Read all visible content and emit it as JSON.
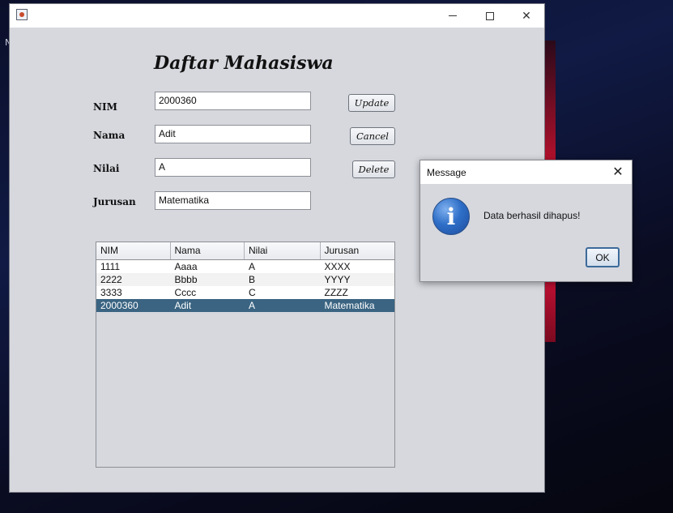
{
  "background": {
    "letter": "N"
  },
  "window": {
    "title": ""
  },
  "form": {
    "heading": "Daftar Mahasiswa",
    "labels": {
      "nim": "NIM",
      "nama": "Nama",
      "nilai": "Nilai",
      "jurusan": "Jurusan"
    },
    "values": {
      "nim": "2000360",
      "nama": "Adit",
      "nilai": "A",
      "jurusan": "Matematika"
    },
    "buttons": {
      "update": "Update",
      "cancel": "Cancel",
      "delete": "Delete"
    }
  },
  "table": {
    "columns": [
      "NIM",
      "Nama",
      "Nilai",
      "Jurusan"
    ],
    "rows": [
      [
        "1111",
        "Aaaa",
        "A",
        "XXXX"
      ],
      [
        "2222",
        "Bbbb",
        "B",
        "YYYY"
      ],
      [
        "3333",
        "Cccc",
        "C",
        "ZZZZ"
      ],
      [
        "2000360",
        "Adit",
        "A",
        "Matematika"
      ]
    ],
    "selected_row": 3
  },
  "dialog": {
    "title": "Message",
    "icon": "info-icon",
    "message": "Data berhasil dihapus!",
    "ok_label": "OK"
  },
  "colors": {
    "selection": "#3a6482",
    "accent": "#2f6fc8"
  }
}
